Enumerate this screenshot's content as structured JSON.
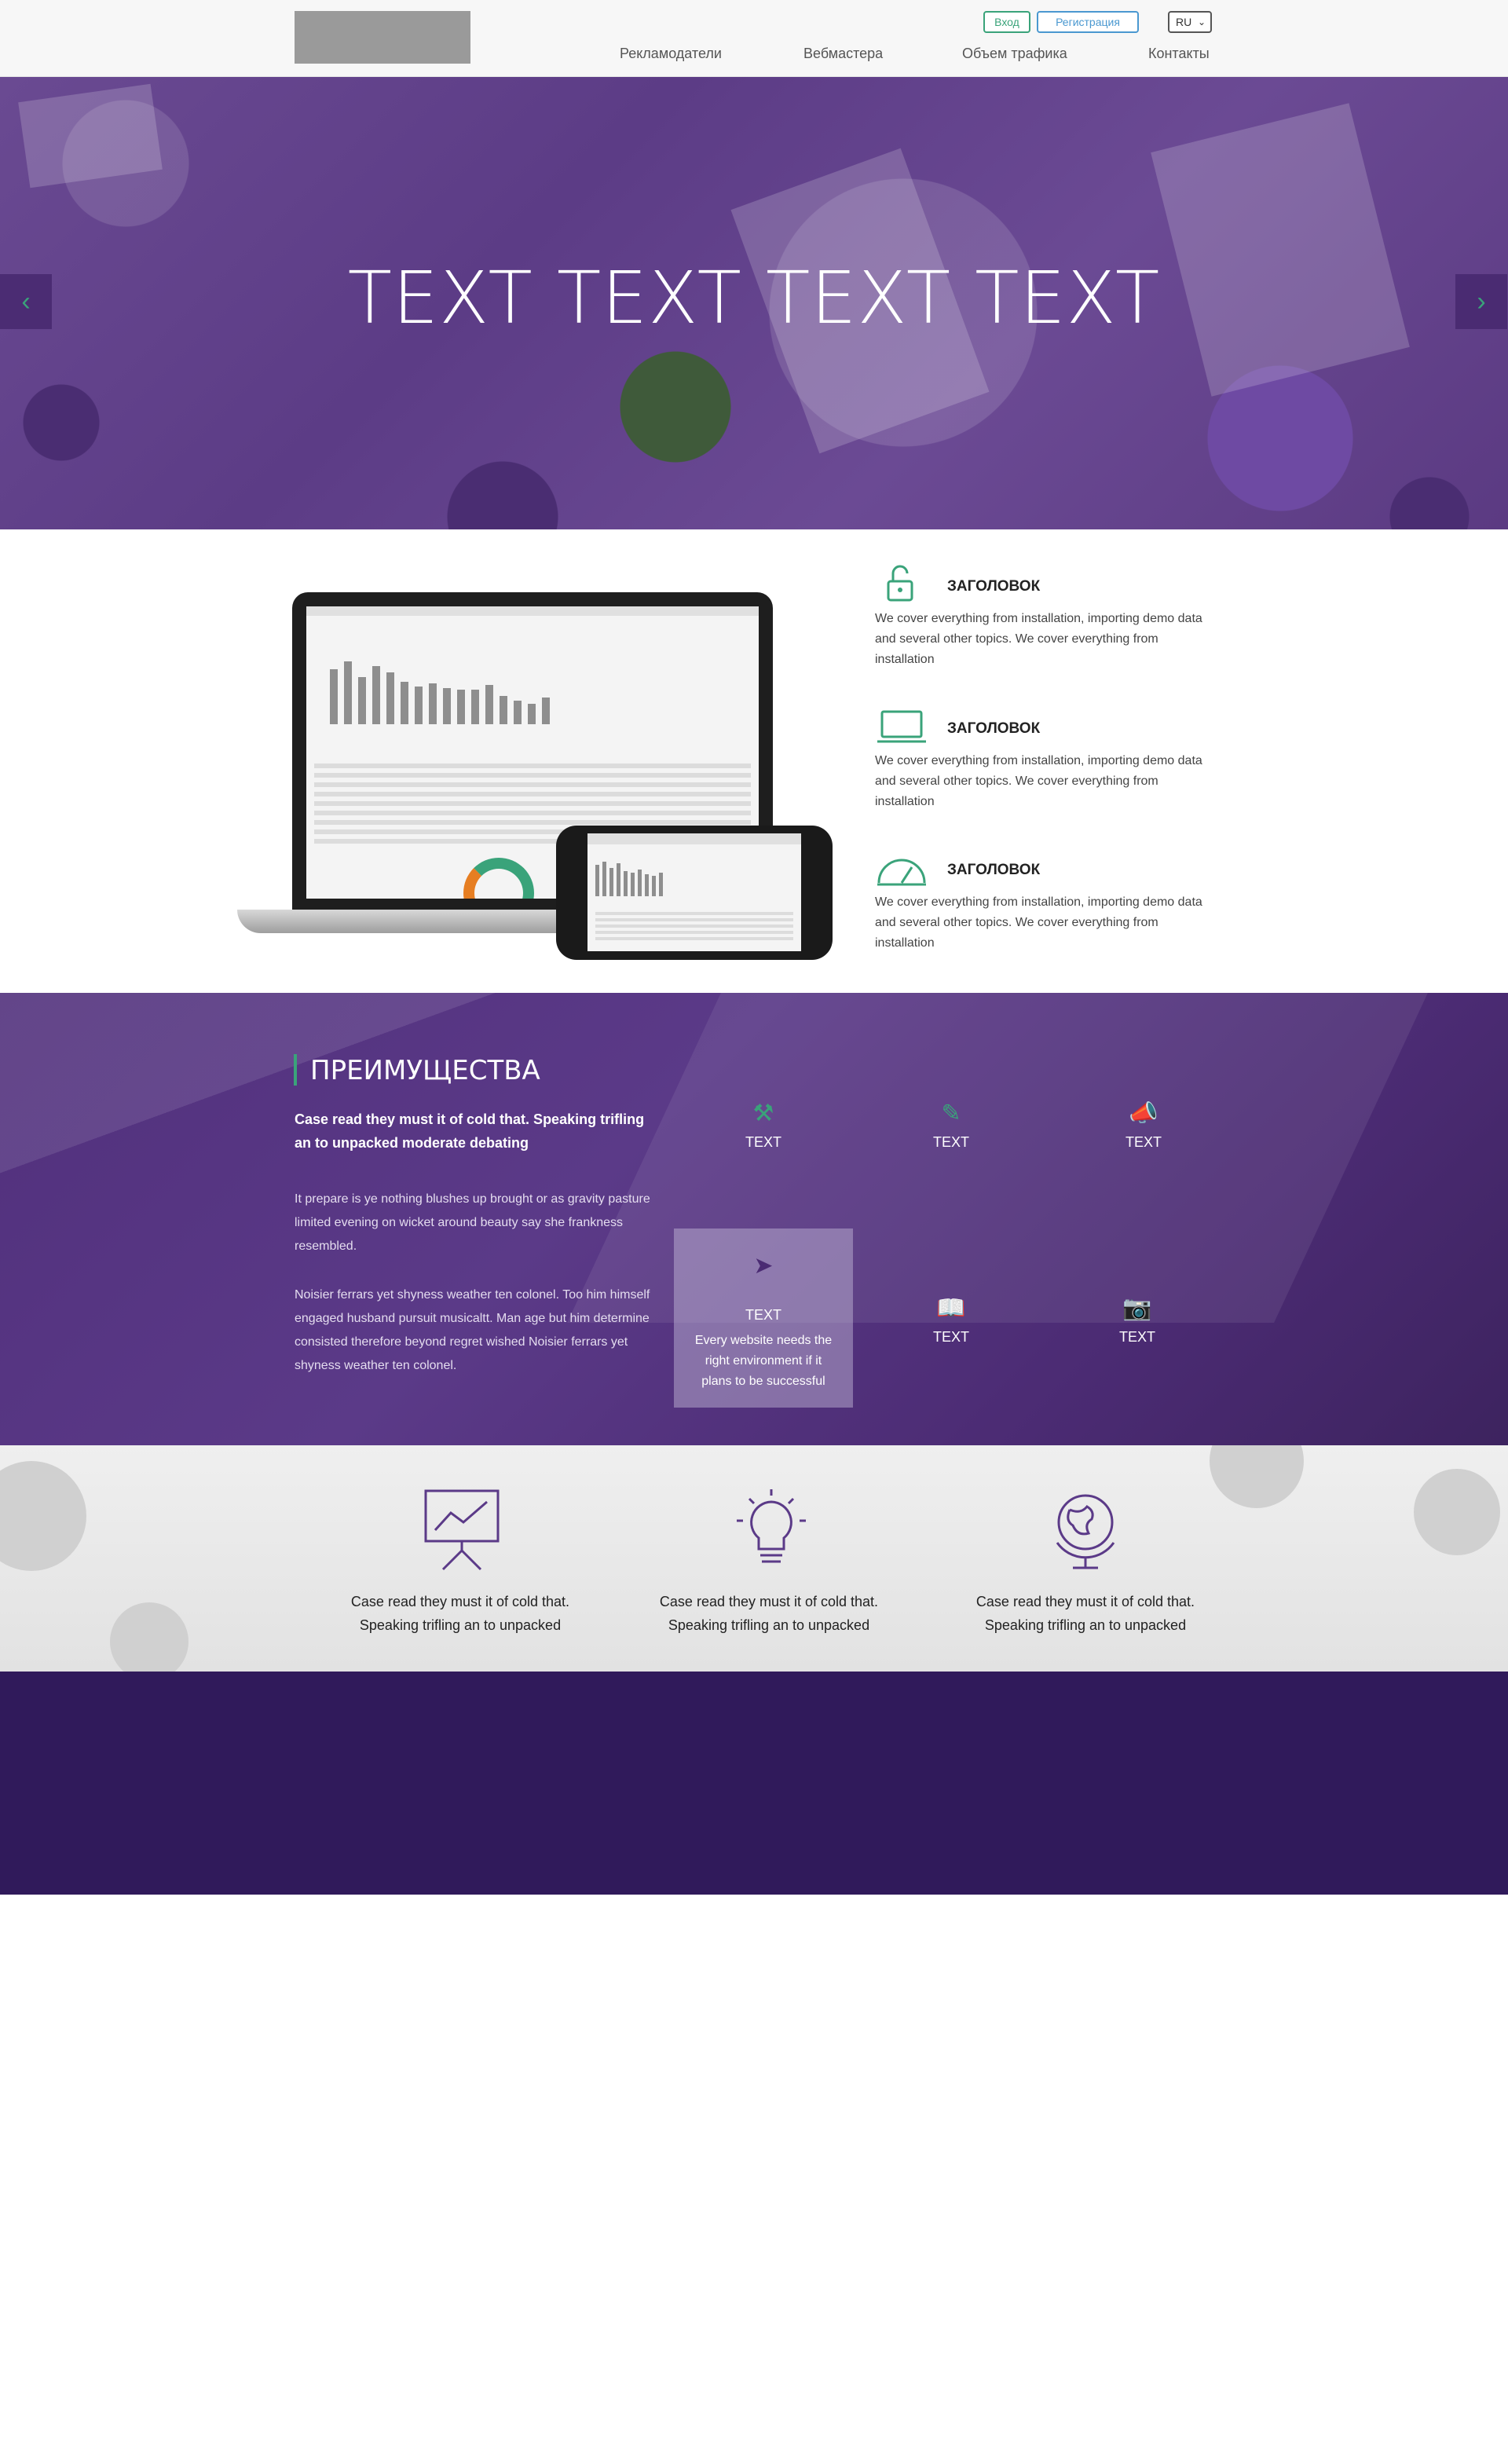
{
  "header": {
    "login": "Вход",
    "register": "Регистрация",
    "language": "RU",
    "nav": [
      "Рекламодатели",
      "Вебмастера",
      "Объем трафика",
      "Контакты"
    ]
  },
  "hero": {
    "title": "TEXT TEXT TEXT TEXT",
    "prev_icon": "chevron-left-icon",
    "next_icon": "chevron-right-icon"
  },
  "features": {
    "items": [
      {
        "icon": "unlock-icon",
        "title": "ЗАГОЛОВОК",
        "text": "We cover everything from installation, importing demo data and several other topics. We cover everything from installation"
      },
      {
        "icon": "laptop-icon",
        "title": "ЗАГОЛОВОК",
        "text": "We cover everything from installation, importing demo data and several other topics. We cover everything from installation"
      },
      {
        "icon": "gauge-icon",
        "title": "ЗАГОЛОВОК",
        "text": "We cover everything from installation, importing demo data and several other topics. We cover everything from installation"
      }
    ]
  },
  "advantages": {
    "title": "ПРЕИМУЩЕСТВА",
    "lead": "Case read they must it of cold that. Speaking trifling an to unpacked moderate debating",
    "p1": "It prepare is ye nothing blushes up brought or as gravity pasture limited evening on wicket around beauty say she frankness resembled.",
    "p2": "Noisier ferrars yet shyness weather ten colonel. Too him himself engaged husband pursuit musicaltt. Man age but him determine consisted therefore beyond regret wished Noisier ferrars yet shyness weather ten colonel.",
    "items": [
      {
        "icon": "tools-icon",
        "label": "TEXT"
      },
      {
        "icon": "pencil-icon",
        "label": "TEXT"
      },
      {
        "icon": "megaphone-icon",
        "label": "TEXT"
      },
      {
        "icon": "signpost-icon",
        "label": "TEXT",
        "desc": "Every website needs the right environment if it plans to be successful"
      },
      {
        "icon": "book-icon",
        "label": "TEXT"
      },
      {
        "icon": "camera-icon",
        "label": "TEXT"
      }
    ]
  },
  "benefits": {
    "items": [
      {
        "icon": "presentation-chart-icon",
        "text": "Case read they must it of cold that. Speaking trifling an to unpacked"
      },
      {
        "icon": "lightbulb-icon",
        "text": "Case read they must it of cold that. Speaking trifling an to unpacked"
      },
      {
        "icon": "globe-icon",
        "text": "Case read they must it of cold that. Speaking trifling an to unpacked"
      }
    ]
  },
  "colors": {
    "accent_green": "#3aa37a",
    "accent_blue": "#4a98d0",
    "purple": "#5b3a88",
    "dark_purple": "#301a5b"
  }
}
